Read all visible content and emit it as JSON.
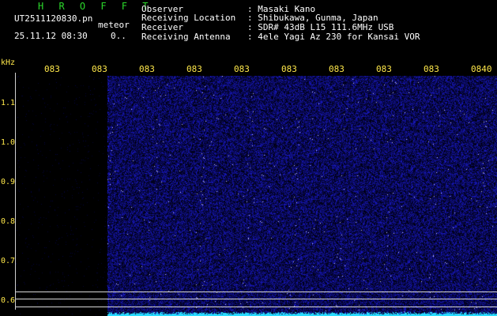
{
  "app": {
    "title": "H R O F F T",
    "filename": "UT2511120830.pn",
    "detection_type": "meteor",
    "datetime": "25.11.12 08:30",
    "count": "0.."
  },
  "info": {
    "rows": [
      {
        "label": "Observer",
        "value": ": Masaki Kano"
      },
      {
        "label": "Receiving Location",
        "value": ": Shibukawa, Gunma, Japan"
      },
      {
        "label": "Receiver",
        "value": ": SDR# 43dB L15 111.6MHz USB"
      },
      {
        "label": "Receiving Antenna",
        "value": ": 4ele Yagi Az 230 for Kansai VOR"
      }
    ]
  },
  "axes": {
    "y_unit": "kHz",
    "time_ticks": [
      "083",
      "083",
      "083",
      "083",
      "083",
      "083",
      "083",
      "083",
      "083",
      "0840"
    ],
    "freq_ticks": [
      "1.1",
      "1.0",
      "0.9",
      "0.8",
      "0.7",
      "0.6"
    ]
  },
  "colors": {
    "background": "#000000",
    "spectrogram_noise": "#1a1aa8",
    "baseline": "#20e0ff",
    "header_text": "#ffffff",
    "title_text": "#2bd82b",
    "axis_text": "#ffe84a"
  }
}
